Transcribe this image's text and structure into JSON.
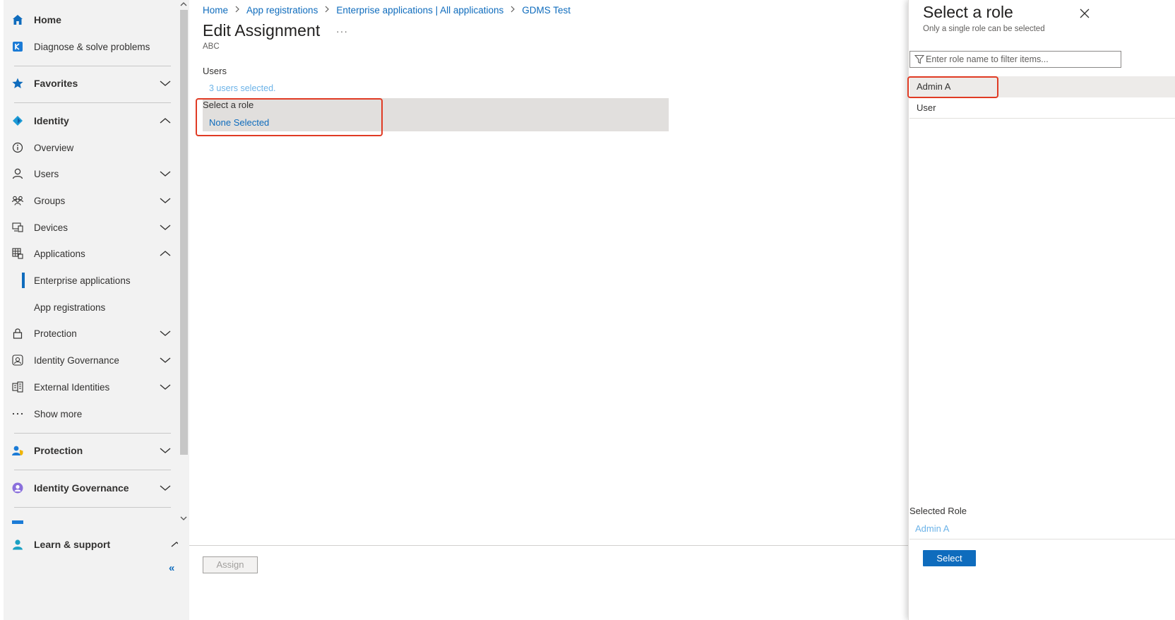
{
  "sidebar": {
    "home": "Home",
    "diagnose": "Diagnose & solve problems",
    "favorites": "Favorites",
    "identity": "Identity",
    "overview": "Overview",
    "users": "Users",
    "groups": "Groups",
    "devices": "Devices",
    "applications": "Applications",
    "enterprise_applications": "Enterprise applications",
    "app_registrations": "App registrations",
    "protection_sub": "Protection",
    "identity_governance_sub": "Identity Governance",
    "external_identities": "External Identities",
    "show_more": "Show more",
    "protection": "Protection",
    "identity_governance": "Identity Governance",
    "learn_support": "Learn & support",
    "collapse": "«"
  },
  "breadcrumb": [
    "Home",
    "App registrations",
    "Enterprise applications | All applications",
    "GDMS Test"
  ],
  "main": {
    "title": "Edit Assignment",
    "more": "···",
    "subtitle": "ABC",
    "users_label": "Users",
    "users_value": "3 users selected.",
    "role_label": "Select a role",
    "role_value": "None Selected",
    "assign_button": "Assign"
  },
  "panel": {
    "title": "Select a role",
    "subtitle": "Only a single role can be selected",
    "filter_placeholder": "Enter role name to filter items...",
    "roles": [
      "Admin A",
      "User"
    ],
    "selected_role_label": "Selected Role",
    "selected_role_value": "Admin A",
    "select_button": "Select"
  },
  "colors": {
    "accent": "#0f6cbd",
    "highlight_box": "#e03b24",
    "link_light": "#6cb3e8"
  }
}
